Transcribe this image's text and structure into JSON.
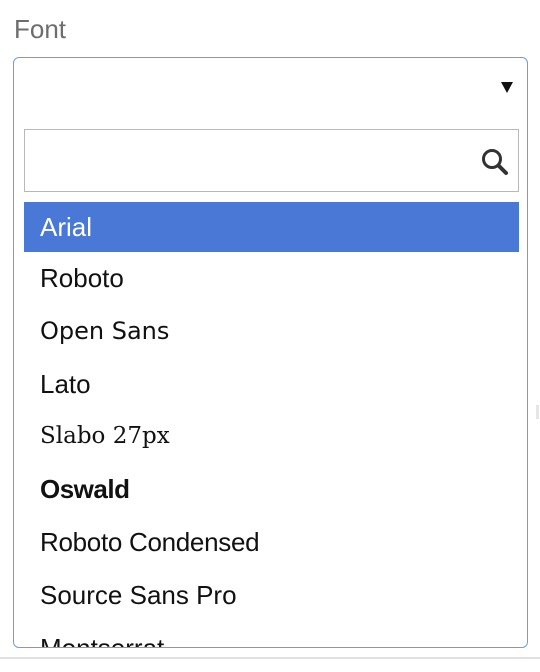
{
  "field": {
    "label": "Font"
  },
  "select": {
    "selected_value": "",
    "accent_color": "#4a78d6",
    "border_color": "#6e9de6"
  },
  "search": {
    "value": "",
    "placeholder": "",
    "icon": "search-icon"
  },
  "options": [
    {
      "label": "Arial",
      "highlighted": true
    },
    {
      "label": "Roboto",
      "highlighted": false
    },
    {
      "label": "Open Sans",
      "highlighted": false
    },
    {
      "label": "Lato",
      "highlighted": false
    },
    {
      "label": "Slabo 27px",
      "highlighted": false
    },
    {
      "label": "Oswald",
      "highlighted": false
    },
    {
      "label": "Roboto Condensed",
      "highlighted": false
    },
    {
      "label": "Source Sans Pro",
      "highlighted": false
    },
    {
      "label": "Montserrat",
      "highlighted": false
    }
  ]
}
